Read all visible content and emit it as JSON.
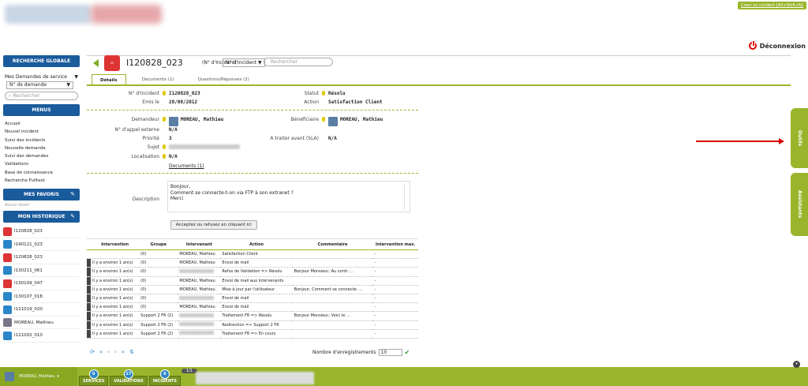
{
  "header": {
    "create_link": "Créer un incident [Alt+Shift+N]",
    "logout": "Déconnexion"
  },
  "sidebar": {
    "global_search": "RECHERCHE GLOBALE",
    "select1": "Mes Demandes de service",
    "select2": "N° de demande",
    "search_placeholder": "Rechercher",
    "menus_title": "MENUS",
    "menu_items": [
      "Accueil",
      "Nouvel incident",
      "Suivi des incidents",
      "Nouvelle demande",
      "Suivi des demandes",
      "Validations",
      "Base de connaissance",
      "Recherche Fulltext"
    ],
    "favoris_title": "MES FAVORIS",
    "favoris_empty": "Aucun favori",
    "historique_title": "MON HISTORIQUE",
    "history": [
      {
        "label": "I120828_023",
        "color": "red"
      },
      {
        "label": "I140121_023",
        "color": "blue"
      },
      {
        "label": "I120828_023",
        "color": "red"
      },
      {
        "label": "I130211_061",
        "color": "blue"
      },
      {
        "label": "I130109_047",
        "color": "red"
      },
      {
        "label": "I130107_018",
        "color": "blue"
      },
      {
        "label": "I121019_020",
        "color": "blue"
      },
      {
        "label": "MOREAU, Mathieu",
        "color": "grey"
      },
      {
        "label": "I121002_010",
        "color": "blue"
      }
    ]
  },
  "incident": {
    "number": "I120828_023",
    "sub": "(N° d'Incident)",
    "select": "N° d'Incident",
    "search_placeholder": "Rechercher"
  },
  "tabs": [
    {
      "label": "Détails",
      "active": true
    },
    {
      "label": "Documents  (1)"
    },
    {
      "label": "Questions/Réponses  (2)"
    }
  ],
  "details": {
    "num_label": "N° d'Incident",
    "num_value": "I120828_023",
    "emis_label": "Emis le",
    "emis_value": "28/08/2012",
    "statut_label": "Statut",
    "statut_value": "Résolu",
    "action_label": "Action",
    "action_value": "Satisfaction Client",
    "demandeur_label": "Demandeur",
    "demandeur_value": "MOREAU, Mathieu",
    "beneficiaire_label": "Bénéficiaire",
    "beneficiaire_value": "MOREAU, Mathieu",
    "appel_label": "N° d'appel externe",
    "appel_value": "N/A",
    "priorite_label": "Priorité",
    "priorite_value": "3",
    "sla_label": "A traiter avant (SLA)",
    "sla_value": "N/A",
    "sujet_label": "Sujet",
    "localisation_label": "Localisation",
    "localisation_value": "N/A",
    "documents_link": "Documents (1)",
    "description_label": "Description",
    "description_lines": [
      "Bonjour,",
      "Comment se connecte-t-on via FTP à son extranet ?",
      "Merci"
    ],
    "accept_button": "Acceptez ou refusez en cliquant ici"
  },
  "table": {
    "headers": [
      "Intervention",
      "Groupe",
      "Intervenant",
      "Action",
      "Commentaire",
      "Intervention max."
    ],
    "rows": [
      [
        "",
        "(0)",
        "MOREAU, Mathieu",
        "Satisfaction Client",
        "",
        "-"
      ],
      [
        "Il y a environ 1 an(s)",
        "(0)",
        "MOREAU, Mathieu",
        "Envoi de mail",
        "",
        "-"
      ],
      [
        "Il y a environ 1 an(s)",
        "(0)",
        "",
        "Refus de Validation => Résolu",
        "Bonjour Monsieur,   Au contr ...",
        "-"
      ],
      [
        "Il y a environ 1 an(s)",
        "(0)",
        "MOREAU, Mathieu",
        "Envoi de mail aux intervenants",
        "",
        "-"
      ],
      [
        "Il y a environ 1 an(s)",
        "(0)",
        "MOREAU, Mathieu",
        "Mise à jour par l'utilisateur",
        "Bonjour, Comment se connecte- ...",
        "-"
      ],
      [
        "Il y a environ 1 an(s)",
        "(0)",
        "",
        "Envoi de mail",
        "",
        "-"
      ],
      [
        "Il y a environ 1 an(s)",
        "(0)",
        "MOREAU, Mathieu",
        "Envoi de mail",
        "",
        "-"
      ],
      [
        "Il y a environ 1 an(s)",
        "Support 2 FR (2)",
        "",
        "Traitement FR => Résolu",
        "Bonjour Monsieur,   Voici le ...",
        "-"
      ],
      [
        "Il y a environ 1 an(s)",
        "Support 2 FR (2)",
        "",
        "Redirection => Support 2 FR",
        "",
        "-"
      ],
      [
        "Il y a environ 1 an(s)",
        "Support 2 FR (2)",
        "",
        "Traitement FR => En cours",
        "",
        "-"
      ]
    ],
    "count_label": "Nombre d'enregistrements",
    "count_value": "10"
  },
  "side_tabs": [
    "Outils",
    "Assistants"
  ],
  "bottombar": {
    "user": "MOREAU, Mathieu",
    "buttons": [
      {
        "label": "SERVICES",
        "badge": "0"
      },
      {
        "label": "VALIDATIONS",
        "badge": "27"
      },
      {
        "label": "INCIDENTS",
        "badge": "0"
      }
    ],
    "page": "1/1"
  }
}
